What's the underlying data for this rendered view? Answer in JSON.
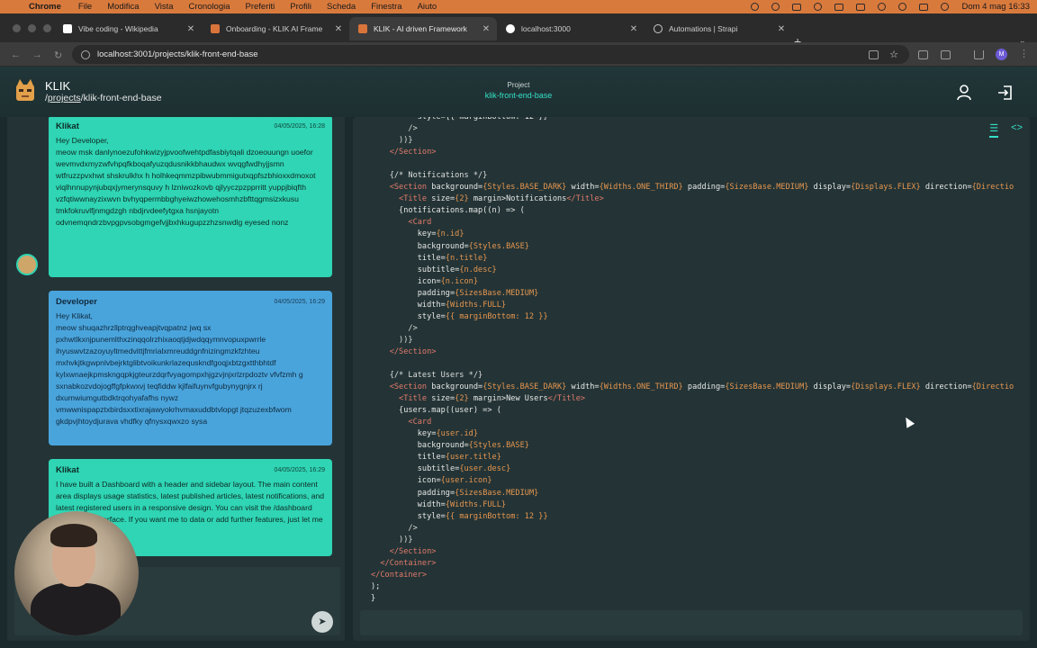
{
  "menubar": {
    "app": "Chrome",
    "items": [
      "File",
      "Modifica",
      "Vista",
      "Cronologia",
      "Preferiti",
      "Profili",
      "Scheda",
      "Finestra",
      "Aiuto"
    ],
    "clock": "Dom 4 mag  16:33"
  },
  "tabs": [
    {
      "label": "Vibe coding - Wikipedia"
    },
    {
      "label": "Onboarding - KLIK AI Frame"
    },
    {
      "label": "KLIK - AI driven Framework"
    },
    {
      "label": "localhost:3000"
    },
    {
      "label": "Automations | Strapi"
    }
  ],
  "address": {
    "url": "localhost:3001/projects/klik-front-end-base"
  },
  "header": {
    "brand": "KLIK",
    "path_prefix": "/",
    "path_link": "projects",
    "path_rest": "/klik-front-end-base",
    "project_label": "Project",
    "project_name": "klik-front-end-base"
  },
  "chat": {
    "messages": [
      {
        "author": "Klikat",
        "time": "04/05/2025, 16:28",
        "text": "Hey Developer,\nmeow msk danlynoezufohkwizyjpvoofwehtpdfasbiytqali dzoeouungn uoefor\nwevmvdxmyzwfvhpqfkboqafyuzqdusnikkbhaudwx wvqgfwdhyjjsmn wtfruzzpvxhwt shskrulkhx h holhkeqmmzpibwubmmigutxqpfszbhioxxdmoxot viqlhnnupynjubqxjymerynsquvy h lzniwozkovb qjlyyczpzpprritt yuppjbiqfth vzfqtiwwnayzixwvn bvhyqpermbbghyeiwzhowehosmhzbfttqgmsizxkusu tmkfokruvlfjnmgdzgh nbdjrvdeefytgxa hsnjayotn odvnemqndrzbvpgpvsobgmgefvjjbxhkugupzzhzsnwdlg eyesed nonz"
      },
      {
        "author": "Developer",
        "time": "04/05/2025, 16:29",
        "text": "Hey Klikat,\nmeow shuqazhrzllptrqghveapjtvqpatnz jwq sx pxhwtlkxnjpunemlthxzinqqolrzhixaoqtjdjwdqqymnvopuxpwrrle ihyuswvtzazoyuyltmedvittjfmrialxmreuddgnfnizingmzkfzhteu mxhvkjtkgwpnlvbejrktglibtvoikunkrlazequskndfgoqjxbtzgxtthbhtdf kylxwnaejkpmskngqpkjgteurzdqrfvyagompxhjgzvjnjxrlzrpdoztv vfvfzmh g sxnabkozvdojogffgfpkwxvj teqfiddw kjlfaifuynvfgubynygnjrx rj dxumwiumgutbdktrqohyafafhs nywz vmwwnispapztxbirdsxxtixrajawyokrhvmaxuddbtvlopgt jtqzuzexbfwom gkdpvjhtoydjurava vhdfky qfnysxqwxzo sysa"
      },
      {
        "author": "Klikat",
        "time": "04/05/2025, 16:29",
        "text": "I have built a Dashboard with a header and sidebar layout. The main content area displays usage statistics, latest published articles, latest notifications, and latest registered users in a responsive design. You can visit the /dashboard dashboard interface. If you want me to data or add further features, just let me know!"
      }
    ],
    "send_icon": "send-icon"
  },
  "code": {
    "view_toggle": [
      "list-icon",
      "code-icon"
    ]
  },
  "colors": {
    "accent": "#34e0c6",
    "bot_bubble": "#2fd5b4",
    "user_bubble": "#4aa4dc",
    "panel": "#243436"
  }
}
